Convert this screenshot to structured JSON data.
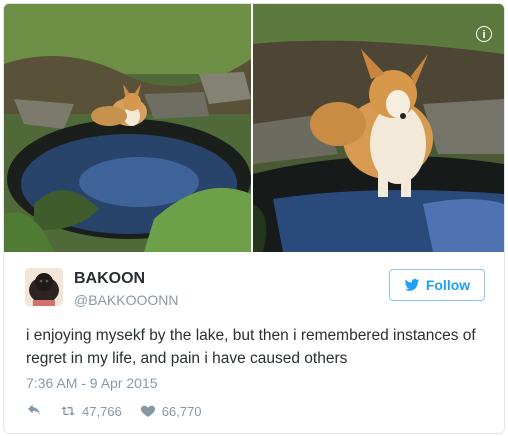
{
  "tweet": {
    "name": "BAKOON",
    "handle": "@BAKKOOONN",
    "follow_label": "Follow",
    "text": "i enjoying mysekf by the lake, but then i remembered instances of regret in my life, and pain i have caused others",
    "timestamp": "7:36 AM - 9 Apr 2015",
    "retweets": "47,766",
    "likes": "66,770",
    "info_glyph": "i"
  },
  "colors": {
    "accent": "#1da1f2",
    "muted": "#8899a6",
    "text": "#292f33",
    "border": "#e1e8ed"
  },
  "icons": [
    "info-icon",
    "twitter-bird-icon",
    "reply-icon",
    "retweet-icon",
    "heart-icon"
  ]
}
